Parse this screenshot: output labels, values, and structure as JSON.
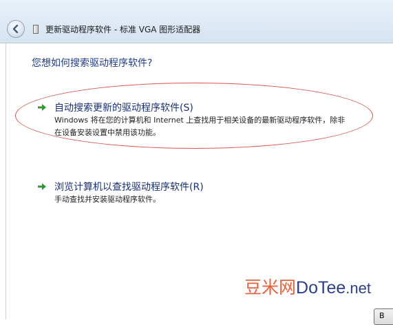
{
  "window": {
    "title": "更新驱动程序软件 - 标准 VGA 图形适配器"
  },
  "prompt": {
    "question": "您想如何搜索驱动程序软件?"
  },
  "options": [
    {
      "title": "自动搜索更新的驱动程序软件(S)",
      "description": "Windows 将在您的计算机和 Internet 上查找用于相关设备的最新驱动程序软件，除非在设备安装设置中禁用该功能。"
    },
    {
      "title": "浏览计算机以查找驱动程序软件(R)",
      "description": "手动查找并安装驱动程序软件。"
    }
  ],
  "watermark": {
    "part1": "豆米网",
    "part2": "DoTee",
    "part3": ".net"
  },
  "footer": {
    "next_button": "B"
  },
  "colors": {
    "accent": "#1e3e8c",
    "arrow": "#2e9b2e",
    "annotation": "#d9534f"
  }
}
